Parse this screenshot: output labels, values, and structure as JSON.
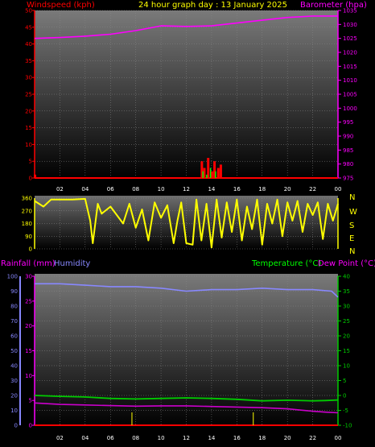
{
  "header": {
    "wind_label": "Windspeed (kph)",
    "title": "24 hour graph day : 13 January 2025",
    "baro_label": "Barometer (hpa)"
  },
  "lower_header": {
    "rain_label": "Rainfall (mm)",
    "hum_label": "Humidity",
    "temp_label": "Temperature (°C)",
    "dew_label": "Dew Point (°C)"
  },
  "compass_labels": [
    "N",
    "W",
    "S",
    "E",
    "N"
  ],
  "colors": {
    "wind": "#ff0000",
    "gust": "#00ff00",
    "baro": "#ff00ff",
    "direction": "#ffff00",
    "rain": "#ff00ff",
    "humidity": "#8888ff",
    "temperature": "#00cc00",
    "dewpoint": "#cc00cc",
    "rain_rate": "#ff0000",
    "hour_tick": "#ffff00"
  },
  "chart_data": [
    {
      "type": "line",
      "panel": "wind-pressure",
      "x_ticks": [
        "02",
        "04",
        "06",
        "08",
        "10",
        "12",
        "14",
        "16",
        "18",
        "20",
        "22",
        "00"
      ],
      "y_left_ticks": [
        "0",
        "5",
        "10",
        "15",
        "20",
        "25",
        "30",
        "35",
        "40",
        "45",
        "50"
      ],
      "y_right_ticks": [
        "975",
        "980",
        "985",
        "990",
        "995",
        "1000",
        "1005",
        "1010",
        "1015",
        "1020",
        "1025",
        "1030",
        "1035"
      ],
      "ylim_left": [
        0,
        50
      ],
      "ylim_right": [
        975,
        1035
      ],
      "series": [
        {
          "name": "Barometer (hpa)",
          "axis": "right",
          "x": [
            0,
            2,
            4,
            6,
            8,
            10,
            12,
            14,
            16,
            18,
            20,
            22,
            24
          ],
          "y": [
            1025,
            1025.3,
            1025.8,
            1026.5,
            1027.8,
            1029.5,
            1029.3,
            1029.5,
            1030.5,
            1031.5,
            1032.5,
            1033,
            1033
          ]
        },
        {
          "name": "Windspeed (kph)",
          "axis": "left",
          "x": [
            0,
            0.2,
            12.9,
            13.2,
            13.4,
            13.7,
            14.0,
            14.2,
            14.5,
            14.7,
            15.0,
            24
          ],
          "y": [
            1,
            0,
            0,
            5,
            3,
            6,
            2,
            5,
            3,
            4,
            0,
            0
          ]
        },
        {
          "name": "Gust (kph)",
          "axis": "left",
          "x": [
            13.3,
            13.6,
            13.9,
            14.3
          ],
          "y": [
            2,
            1,
            3,
            2
          ]
        }
      ]
    },
    {
      "type": "line",
      "panel": "wind-direction",
      "y_ticks": [
        "0",
        "90",
        "180",
        "270",
        "360"
      ],
      "ylim": [
        0,
        360
      ],
      "series": [
        {
          "name": "Wind direction",
          "x": [
            0,
            0.7,
            1.3,
            2.0,
            3.0,
            4.0,
            4.4,
            4.6,
            5.0,
            5.3,
            6.0,
            7.0,
            7.5,
            8.0,
            8.5,
            9.0,
            9.5,
            10.0,
            10.5,
            11.0,
            11.3,
            11.6,
            12.0,
            12.5,
            12.8,
            13.2,
            13.6,
            14.0,
            14.4,
            14.8,
            15.2,
            15.6,
            16.0,
            16.4,
            16.8,
            17.2,
            17.6,
            18.0,
            18.4,
            18.8,
            19.2,
            19.6,
            20.0,
            20.4,
            20.8,
            21.2,
            21.6,
            22.0,
            22.4,
            22.8,
            23.2,
            23.6,
            24.0
          ],
          "y": [
            340,
            300,
            350,
            350,
            350,
            355,
            200,
            40,
            320,
            250,
            300,
            180,
            320,
            150,
            280,
            60,
            330,
            220,
            310,
            40,
            200,
            330,
            40,
            30,
            350,
            60,
            320,
            10,
            350,
            80,
            330,
            120,
            350,
            60,
            300,
            140,
            350,
            30,
            320,
            180,
            350,
            90,
            330,
            200,
            340,
            120,
            320,
            240,
            330,
            70,
            320,
            200,
            320
          ]
        }
      ]
    },
    {
      "type": "line",
      "panel": "temperature-humidity",
      "x_ticks": [
        "02",
        "04",
        "06",
        "08",
        "10",
        "12",
        "14",
        "16",
        "18",
        "20",
        "22",
        "00"
      ],
      "y_humidity_ticks": [
        "0",
        "10",
        "20",
        "30",
        "40",
        "50",
        "60",
        "70",
        "80",
        "90",
        "100"
      ],
      "y_rain_ticks": [
        "0",
        "5",
        "10",
        "15",
        "20",
        "25",
        "30"
      ],
      "y_temp_ticks": [
        "-10",
        "-5",
        "0",
        "5",
        "10",
        "15",
        "20",
        "25",
        "30",
        "35",
        "40"
      ],
      "ylim_humidity": [
        0,
        100
      ],
      "ylim_rain": [
        0,
        30
      ],
      "ylim_temp": [
        -10,
        40
      ],
      "series": [
        {
          "name": "Humidity",
          "axis": "humidity",
          "x": [
            0,
            2,
            4,
            6,
            8,
            10,
            12,
            14,
            16,
            18,
            20,
            22,
            23.5,
            24
          ],
          "y": [
            95,
            95,
            94,
            93,
            93,
            92,
            90,
            91,
            91,
            92,
            91,
            91,
            90,
            86
          ]
        },
        {
          "name": "Temperature (°C)",
          "axis": "temp",
          "x": [
            0,
            2,
            4,
            6,
            8,
            10,
            12,
            14,
            16,
            18,
            20,
            22,
            23,
            24
          ],
          "y": [
            0,
            -0.3,
            -0.5,
            -1,
            -1.2,
            -1,
            -0.8,
            -1,
            -1.3,
            -1.8,
            -1.6,
            -1.8,
            -1.7,
            -1.5
          ]
        },
        {
          "name": "Dew Point (°C)",
          "axis": "temp",
          "x": [
            0,
            2,
            4,
            6,
            8,
            10,
            12,
            14,
            16,
            18,
            20,
            22,
            23,
            24
          ],
          "y": [
            -2.5,
            -3,
            -3.2,
            -3.4,
            -3.6,
            -3.5,
            -3.5,
            -3.7,
            -3.9,
            -4.1,
            -4.5,
            -5.3,
            -5.6,
            -5.8
          ]
        },
        {
          "name": "Rainfall (mm)",
          "axis": "rain",
          "x": [
            0,
            24
          ],
          "y": [
            0,
            0
          ]
        }
      ],
      "hour_markers": [
        7.7,
        17.3
      ]
    }
  ]
}
